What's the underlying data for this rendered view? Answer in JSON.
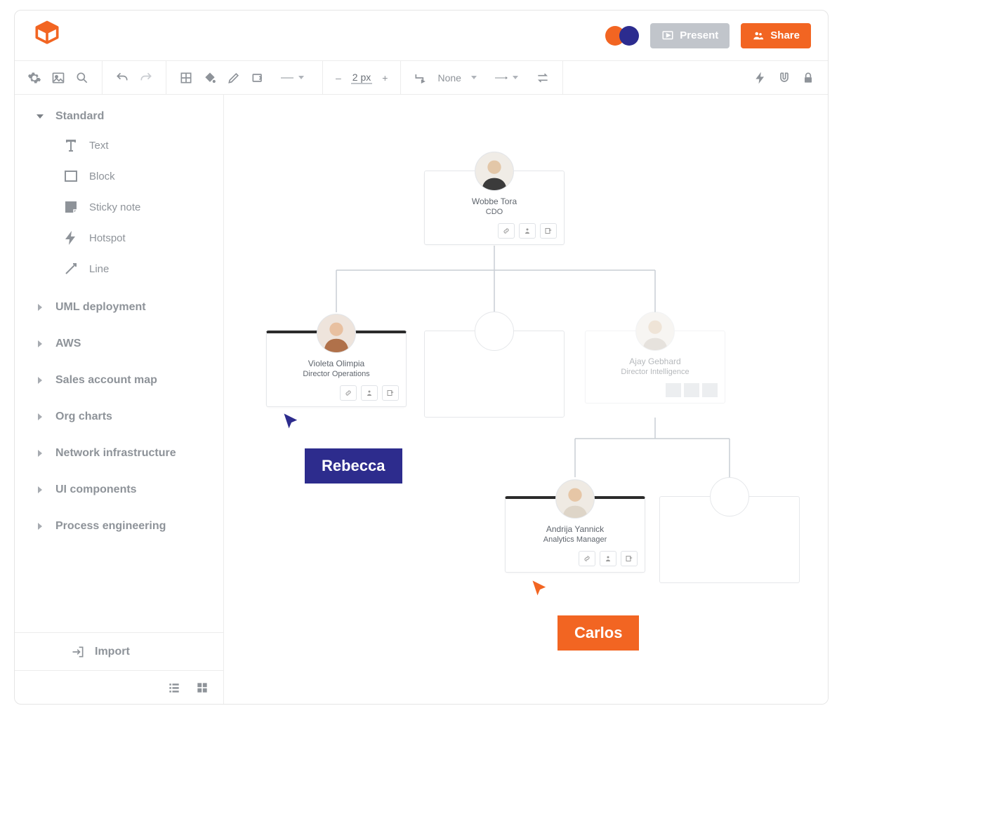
{
  "header": {
    "present_label": "Present",
    "share_label": "Share"
  },
  "toolbar": {
    "stroke_width": "2 px",
    "line_style": "None"
  },
  "sidebar": {
    "groups": [
      {
        "label": "Standard",
        "expanded": true
      },
      {
        "label": "UML deployment",
        "expanded": false
      },
      {
        "label": "AWS",
        "expanded": false
      },
      {
        "label": "Sales account map",
        "expanded": false
      },
      {
        "label": "Org charts",
        "expanded": false
      },
      {
        "label": "Network infrastructure",
        "expanded": false
      },
      {
        "label": "UI components",
        "expanded": false
      },
      {
        "label": "Process engineering",
        "expanded": false
      }
    ],
    "shapes": [
      {
        "label": "Text"
      },
      {
        "label": "Block"
      },
      {
        "label": "Sticky note"
      },
      {
        "label": "Hotspot"
      },
      {
        "label": "Line"
      }
    ],
    "import_label": "Import"
  },
  "canvas": {
    "cards": {
      "root": {
        "name": "Wobbe Tora",
        "title": "CDO"
      },
      "left": {
        "name": "Violeta Olimpia",
        "title": "Director Operations"
      },
      "right_ghost": {
        "name": "Ajay Gebhard",
        "title": "Director Intelligence"
      },
      "grand": {
        "name": "Andrija Yannick",
        "title": "Analytics Manager"
      }
    },
    "cursors": {
      "blue_label": "Rebecca",
      "orange_label": "Carlos"
    }
  }
}
